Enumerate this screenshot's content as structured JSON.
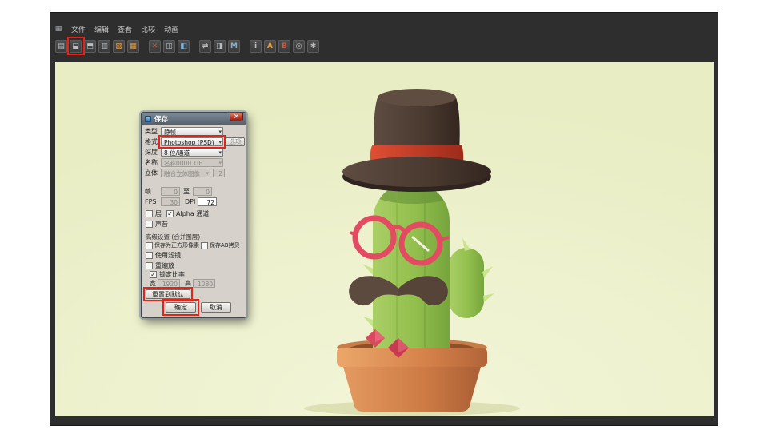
{
  "colors": {
    "viewport_bg": "#edf1cc",
    "annotation_red": "#e62318",
    "cactus_green": "#92bf4d",
    "pot_terracotta": "#cd7a44",
    "hat_brown": "#49392f",
    "accent_red": "#e24b61"
  },
  "menubar": {
    "app_icon_glyph": "▦",
    "items": [
      {
        "label": "文件"
      },
      {
        "label": "编辑"
      },
      {
        "label": "查看"
      },
      {
        "label": "比较"
      },
      {
        "label": "动画"
      }
    ]
  },
  "toolbar": {
    "icons": [
      {
        "name": "history-icon",
        "glyph": "▤"
      },
      {
        "name": "save-icon",
        "glyph": "⬓"
      },
      {
        "name": "save-as-icon",
        "glyph": "⬒"
      },
      {
        "name": "copy-icon",
        "glyph": "▥"
      },
      {
        "name": "folder-icon",
        "glyph": "▧"
      },
      {
        "name": "image-icon",
        "glyph": "▦"
      },
      {
        "name": "delete-icon",
        "glyph": "✕"
      },
      {
        "name": "layers-icon",
        "glyph": "◫"
      },
      {
        "name": "compare-ab-icon",
        "glyph": "◧"
      },
      {
        "name": "swap-ab-icon",
        "glyph": "⇄"
      },
      {
        "name": "split-view-icon",
        "glyph": "◨"
      },
      {
        "name": "histogram-icon",
        "glyph": "M"
      },
      {
        "name": "info-icon",
        "glyph": "i"
      },
      {
        "name": "version-a-icon",
        "glyph": "A"
      },
      {
        "name": "version-b-icon",
        "glyph": "B"
      },
      {
        "name": "zoom-icon",
        "glyph": "◎"
      },
      {
        "name": "settings-icon",
        "glyph": "✱"
      }
    ]
  },
  "dialog": {
    "title": "保存",
    "close": "×",
    "type": {
      "label": "类型",
      "value": "静帧"
    },
    "format": {
      "label": "格式",
      "value": "Photoshop (PSD)",
      "options": "选项"
    },
    "depth": {
      "label": "深度",
      "value": "8 位/通道"
    },
    "name": {
      "label": "名称",
      "value": "名称0000.TIF"
    },
    "stereo": {
      "label": "立体",
      "value": "融合立体图像",
      "extra": "2"
    },
    "frame": {
      "label": "帧",
      "from": "0",
      "to_label": "至",
      "to": "0"
    },
    "fps": {
      "label": "FPS",
      "value": "30"
    },
    "dpi": {
      "label": "DPI",
      "value": "72"
    },
    "layers": {
      "label": "层",
      "checked": ""
    },
    "alpha": {
      "label": "Alpha 通道",
      "checked": "✓"
    },
    "sound": {
      "label": "声音",
      "checked": ""
    },
    "advanced_header": "高级设置 (合并图层)",
    "square_pixels": {
      "label": "保存为正方形像素",
      "checked": ""
    },
    "ab_copy": {
      "label": "保存AB拷贝",
      "checked": ""
    },
    "use_filter": {
      "label": "使用滤镜",
      "checked": ""
    },
    "rescale": {
      "label": "重缩放",
      "checked": ""
    },
    "lock_ratio": {
      "label": "锁定比率",
      "checked": "✓"
    },
    "width": {
      "label": "宽",
      "value": "1920"
    },
    "height": {
      "label": "高",
      "value": "1080"
    },
    "reset_button": "重置到默认",
    "ok_button": "确定",
    "cancel_button": "取消"
  }
}
